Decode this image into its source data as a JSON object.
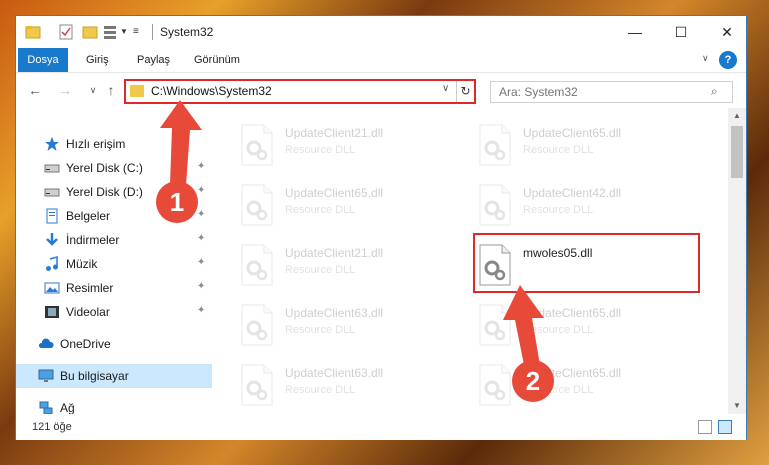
{
  "window": {
    "title": "System32",
    "controls": {
      "minimize": "—",
      "maximize": "☐",
      "close": "✕"
    }
  },
  "ribbon": {
    "tabs": [
      "Dosya",
      "Giriş",
      "Paylaş",
      "Görünüm"
    ],
    "help": "?"
  },
  "nav": {
    "back": "←",
    "forward": "→",
    "recent": "∨",
    "up": "↑",
    "address": "C:\\Windows\\System32",
    "refresh": "↻",
    "search_placeholder": "Ara: System32"
  },
  "sidebar": {
    "items": [
      {
        "label": "Hızlı erişim",
        "icon": "star-icon",
        "pinned": false
      },
      {
        "label": "Yerel Disk (C:)",
        "icon": "drive-icon",
        "pinned": true
      },
      {
        "label": "Yerel Disk (D:)",
        "icon": "drive-icon",
        "pinned": true
      },
      {
        "label": "Belgeler",
        "icon": "documents-icon",
        "pinned": true
      },
      {
        "label": "İndirmeler",
        "icon": "download-icon",
        "pinned": true
      },
      {
        "label": "Müzik",
        "icon": "music-icon",
        "pinned": true
      },
      {
        "label": "Resimler",
        "icon": "pictures-icon",
        "pinned": true
      },
      {
        "label": "Videolar",
        "icon": "videos-icon",
        "pinned": true
      },
      {
        "label": "OneDrive",
        "icon": "cloud-icon",
        "pinned": false
      },
      {
        "label": "Bu bilgisayar",
        "icon": "computer-icon",
        "pinned": false,
        "selected": true
      },
      {
        "label": "Ağ",
        "icon": "network-icon",
        "pinned": false
      }
    ],
    "pin_glyph": "📌"
  },
  "files": [
    {
      "name": "UpdateClient21.dll",
      "type": "Resource DLL",
      "faded": true
    },
    {
      "name": "UpdateClient65.dll",
      "type": "Resource DLL",
      "faded": true
    },
    {
      "name": "UpdateClient65.dll",
      "type": "Resource DLL",
      "faded": true
    },
    {
      "name": "UpdateClient42.dll",
      "type": "Resource DLL",
      "faded": true
    },
    {
      "name": "UpdateClient21.dll",
      "type": "Resource DLL",
      "faded": true
    },
    {
      "name": "mwoles05.dll",
      "type": "",
      "faded": false
    },
    {
      "name": "UpdateClient63.dll",
      "type": "Resource DLL",
      "faded": true
    },
    {
      "name": "UpdateClient65.dll",
      "type": "Resource DLL",
      "faded": true
    },
    {
      "name": "UpdateClient63.dll",
      "type": "Resource DLL",
      "faded": true
    },
    {
      "name": "UpdateClient65.dll",
      "type": "Resource DLL",
      "faded": true
    }
  ],
  "status": {
    "count": "121 öğe"
  },
  "annotations": {
    "step1": "1",
    "step2": "2",
    "color": "#e02828",
    "callout_color": "#e84a3a"
  }
}
